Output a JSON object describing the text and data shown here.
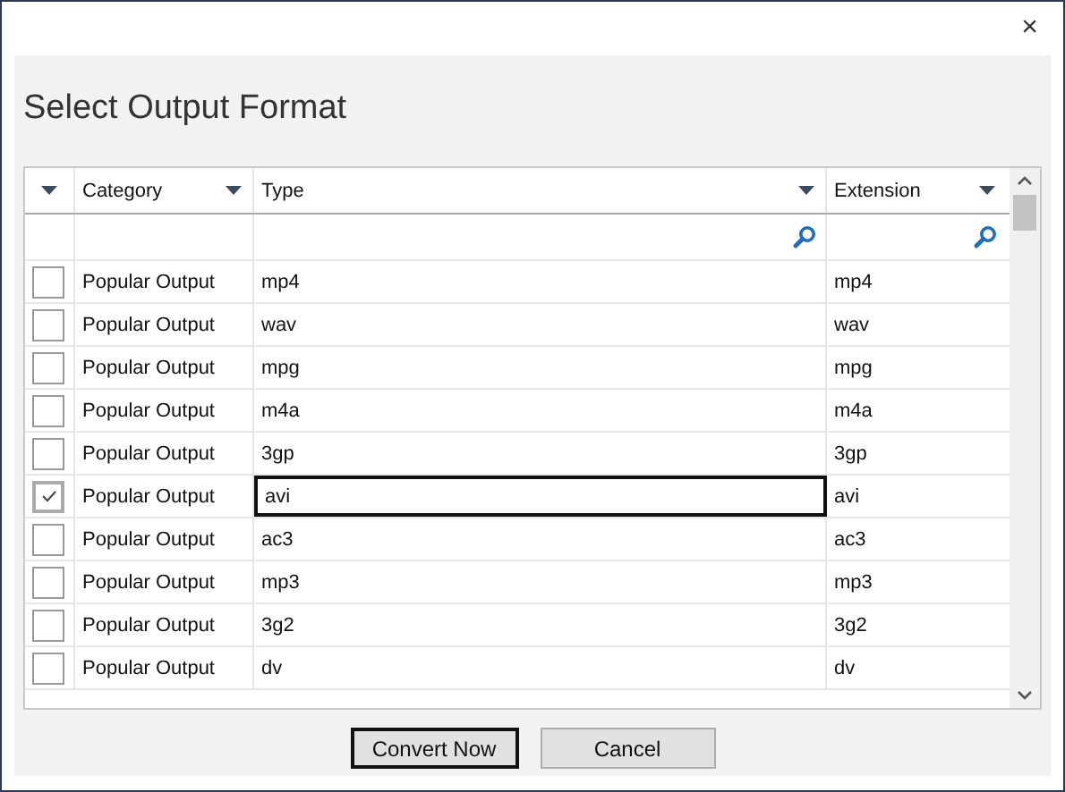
{
  "window": {
    "close": "×"
  },
  "title": "Select Output Format",
  "grid": {
    "columns": [
      {
        "kind": "menu"
      },
      {
        "label": "Category"
      },
      {
        "label": "Type"
      },
      {
        "label": "Extension"
      }
    ],
    "filters": [
      {
        "kind": "blank"
      },
      {
        "kind": "blank"
      },
      {
        "kind": "search"
      },
      {
        "kind": "search"
      }
    ],
    "rows": [
      {
        "category": "Popular Output",
        "type": "mp4",
        "extension": "mp4",
        "checked": false,
        "selected": false
      },
      {
        "category": "Popular Output",
        "type": "wav",
        "extension": "wav",
        "checked": false,
        "selected": false
      },
      {
        "category": "Popular Output",
        "type": "mpg",
        "extension": "mpg",
        "checked": false,
        "selected": false
      },
      {
        "category": "Popular Output",
        "type": "m4a",
        "extension": "m4a",
        "checked": false,
        "selected": false
      },
      {
        "category": "Popular Output",
        "type": "3gp",
        "extension": "3gp",
        "checked": false,
        "selected": false
      },
      {
        "category": "Popular Output",
        "type": "avi",
        "extension": "avi",
        "checked": true,
        "selected": true
      },
      {
        "category": "Popular Output",
        "type": "ac3",
        "extension": "ac3",
        "checked": false,
        "selected": false
      },
      {
        "category": "Popular Output",
        "type": "mp3",
        "extension": "mp3",
        "checked": false,
        "selected": false
      },
      {
        "category": "Popular Output",
        "type": "3g2",
        "extension": "3g2",
        "checked": false,
        "selected": false
      },
      {
        "category": "Popular Output",
        "type": "dv",
        "extension": "dv",
        "checked": false,
        "selected": false
      }
    ]
  },
  "buttons": [
    {
      "label": "Convert Now",
      "default": true
    },
    {
      "label": "Cancel",
      "default": false
    }
  ]
}
